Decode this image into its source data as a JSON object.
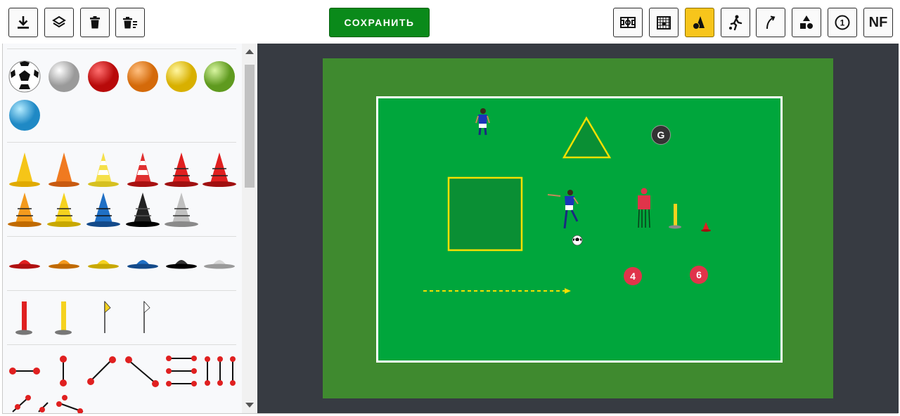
{
  "toolbar": {
    "left_buttons": [
      {
        "name": "download-button",
        "icon": "download-icon"
      },
      {
        "name": "layers-button",
        "icon": "layers-icon"
      },
      {
        "name": "delete-button",
        "icon": "trash-icon"
      },
      {
        "name": "clear-all-button",
        "icon": "trash-list-icon"
      }
    ],
    "save_label": "СОХРАНИТЬ",
    "right_buttons": [
      {
        "name": "field-tool-button",
        "icon": "field-icon"
      },
      {
        "name": "goal-tool-button",
        "icon": "goal-icon"
      },
      {
        "name": "equipment-tool-button",
        "icon": "cone-ball-icon",
        "active": true
      },
      {
        "name": "player-tool-button",
        "icon": "player-icon"
      },
      {
        "name": "arrow-tool-button",
        "icon": "curved-arrow-icon"
      },
      {
        "name": "shapes-tool-button",
        "icon": "shapes-icon"
      },
      {
        "name": "number-tool-button",
        "icon": "numbered-circle-icon",
        "label": "1"
      },
      {
        "name": "nf-tool-button",
        "label": "NF"
      }
    ],
    "colors": {
      "save": "#0a8a1a",
      "active": "#f7c51b"
    }
  },
  "palette": {
    "balls": [
      "soccer",
      "#d0d0d0",
      "#e02020",
      "#f38a1e",
      "#f5d21f",
      "#8cc63f",
      "#3fb2e8"
    ],
    "cones": [
      "#f5c518",
      "#f07a20",
      "#f5e04a-striped",
      "#e03030-striped",
      "#e02020",
      "#e02020",
      "#f39a1e",
      "#f5d21f",
      "#1f6fc5",
      "#222222",
      "#c0c0c0"
    ],
    "discs": [
      "#e02020",
      "#f39a1e",
      "#f5d21f",
      "#1f6fc5",
      "#222222",
      "#d0d0d0"
    ],
    "poles": [
      "#e02020",
      "#f5d21f"
    ],
    "flags": [
      "#f5d21f",
      "#ffffff"
    ]
  },
  "canvas": {
    "goalkeeper_label": "G",
    "markers": [
      {
        "label": "4",
        "color": "#e0344a"
      },
      {
        "label": "6",
        "color": "#e0344a"
      }
    ],
    "colors": {
      "pitch_outer": "#3f8a2f",
      "pitch_inner": "#00a63c",
      "square_stroke": "#f5e000",
      "triangle_stroke": "#f5e000",
      "arrow": "#f5e000"
    }
  }
}
